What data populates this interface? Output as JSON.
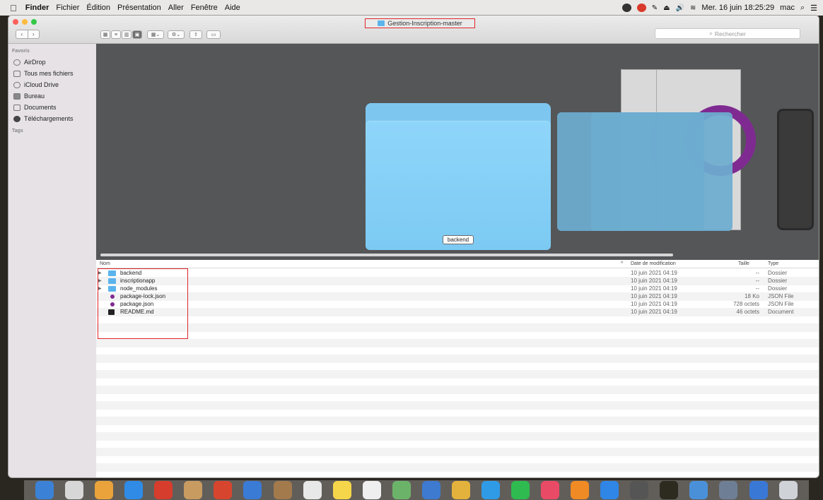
{
  "menubar": {
    "apple": "",
    "items": [
      "Finder",
      "Fichier",
      "Édition",
      "Présentation",
      "Aller",
      "Fenêtre",
      "Aide"
    ],
    "clock": "Mer. 16 juin 18:25:29",
    "user": "mac",
    "search_glyph": "⌕",
    "menu_glyph": "☰"
  },
  "window": {
    "title": "Gestion-Inscription-master",
    "nav_back": "‹",
    "nav_forward": "›",
    "search_placeholder": "Rechercher"
  },
  "sidebar": {
    "favorites_header": "Favoris",
    "items": [
      {
        "label": "AirDrop",
        "icon": "airdrop-icon"
      },
      {
        "label": "Tous mes fichiers",
        "icon": "all-files-icon"
      },
      {
        "label": "iCloud Drive",
        "icon": "cloud-icon"
      },
      {
        "label": "Bureau",
        "icon": "desktop-icon"
      },
      {
        "label": "Documents",
        "icon": "documents-icon"
      },
      {
        "label": "Téléchargements",
        "icon": "downloads-icon"
      }
    ],
    "tags_header": "Tags"
  },
  "preview": {
    "selected_label": "backend"
  },
  "list": {
    "headers": {
      "name": "Nom",
      "sort": "^",
      "date": "Date de modification",
      "size": "Taille",
      "type": "Type"
    },
    "rows": [
      {
        "name": "backend",
        "date": "10 juin 2021 04:19",
        "size": "--",
        "type": "Dossier",
        "kind": "folder"
      },
      {
        "name": "inscriptionapp",
        "date": "10 juin 2021 04:19",
        "size": "--",
        "type": "Dossier",
        "kind": "folder"
      },
      {
        "name": "node_modules",
        "date": "10 juin 2021 04:19",
        "size": "--",
        "type": "Dossier",
        "kind": "folder"
      },
      {
        "name": "package-lock.json",
        "date": "10 juin 2021 04:19",
        "size": "18 Ko",
        "type": "JSON File",
        "kind": "json"
      },
      {
        "name": "package.json",
        "date": "10 juin 2021 04:19",
        "size": "728 octets",
        "type": "JSON File",
        "kind": "json"
      },
      {
        "name": "README.md",
        "date": "10 juin 2021 04:19",
        "size": "46 octets",
        "type": "Document",
        "kind": "md"
      }
    ]
  },
  "colors": {
    "accent_red": "#e0262a",
    "folder_blue": "#5cb4ec"
  }
}
